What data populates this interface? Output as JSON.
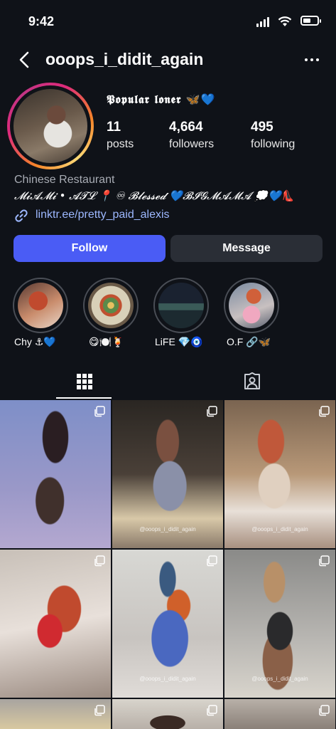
{
  "status_bar": {
    "time": "9:42"
  },
  "header": {
    "username": "ooops_i_didit_again"
  },
  "profile": {
    "display_name": "𝕻𝖔𝖕𝖚𝖑𝖆𝖗 𝖑𝖔𝖓𝖊𝖗 🦋💙",
    "stats": [
      {
        "value": "11",
        "label": "posts"
      },
      {
        "value": "4,664",
        "label": "followers"
      },
      {
        "value": "495",
        "label": "following"
      }
    ],
    "category": "Chinese Restaurant",
    "bio": "𝓜𝓲𝓐𝓜𝓲 • 𝓐𝓣𝓛 📍 ♾ 𝓑𝓵𝓮𝓼𝓼𝓮𝓭 💙𝓑𝓘𝓖𝓜𝓐𝓜𝓐 💭💙👠",
    "link": "linktr.ee/pretty_paid_alexis"
  },
  "actions": {
    "follow_label": "Follow",
    "message_label": "Message"
  },
  "highlights": [
    {
      "label": "Chy ⚓💙"
    },
    {
      "label": "😋🍽️🍹"
    },
    {
      "label": "LiFE 💎🧿"
    },
    {
      "label": "O.F 🔗🦋"
    }
  ],
  "posts": [
    {
      "watermark": ""
    },
    {
      "watermark": "@ooops_i_didit_again"
    },
    {
      "watermark": "@ooops_i_didit_again"
    },
    {
      "watermark": ""
    },
    {
      "watermark": "@ooops_i_didit_again"
    },
    {
      "watermark": "@ooops_i_didit_again"
    }
  ],
  "colors": {
    "accent": "#4a5cf5",
    "link": "#9db8ff",
    "background": "#0f1218"
  }
}
